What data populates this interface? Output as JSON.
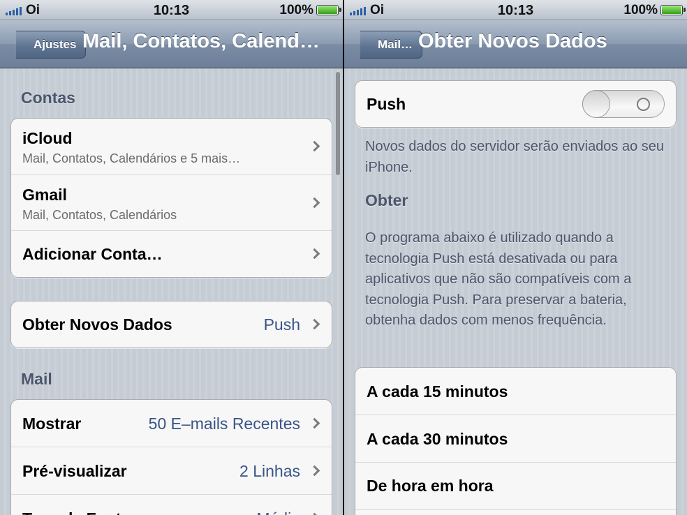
{
  "status_left": {
    "carrier": "Oi",
    "time": "10:13",
    "battery": "100%"
  },
  "status_right": {
    "carrier": "Oi",
    "time": "10:13",
    "battery": "100%"
  },
  "left_screen": {
    "back_label": "Ajustes",
    "title": "Mail, Contatos, Calend…",
    "accounts_header": "Contas",
    "accounts": [
      {
        "label": "iCloud",
        "subtitle": "Mail, Contatos, Calendários e 5 mais…"
      },
      {
        "label": "Gmail",
        "subtitle": "Mail, Contatos, Calendários"
      },
      {
        "label": "Adicionar Conta…"
      }
    ],
    "fetch": {
      "label": "Obter Novos Dados",
      "value": "Push"
    },
    "mail_header": "Mail",
    "mail_rows": [
      {
        "label": "Mostrar",
        "value": "50 E–mails Recentes"
      },
      {
        "label": "Pré-visualizar",
        "value": "2 Linhas"
      },
      {
        "label": "Tam. de Fonte",
        "value": "Médio"
      }
    ]
  },
  "right_screen": {
    "back_label": "Mail…",
    "title": "Obter Novos Dados",
    "push_label": "Push",
    "push_enabled": false,
    "push_note": "Novos dados do servidor serão enviados ao seu iPhone.",
    "fetch_header": "Obter",
    "fetch_note": "O programa abaixo é utilizado quando a tecnologia Push está desativada ou para aplicativos que não são compatíveis com a tecnologia Push. Para preservar a bateria, obtenha dados com menos frequência.",
    "options": [
      "A cada 15 minutos",
      "A cada 30 minutos",
      "De hora em hora"
    ]
  },
  "icons": {
    "signal": "signal-bars-icon",
    "battery": "battery-icon",
    "chevron": "chevron-right-icon",
    "toggle_off": "toggle-off-icon"
  }
}
